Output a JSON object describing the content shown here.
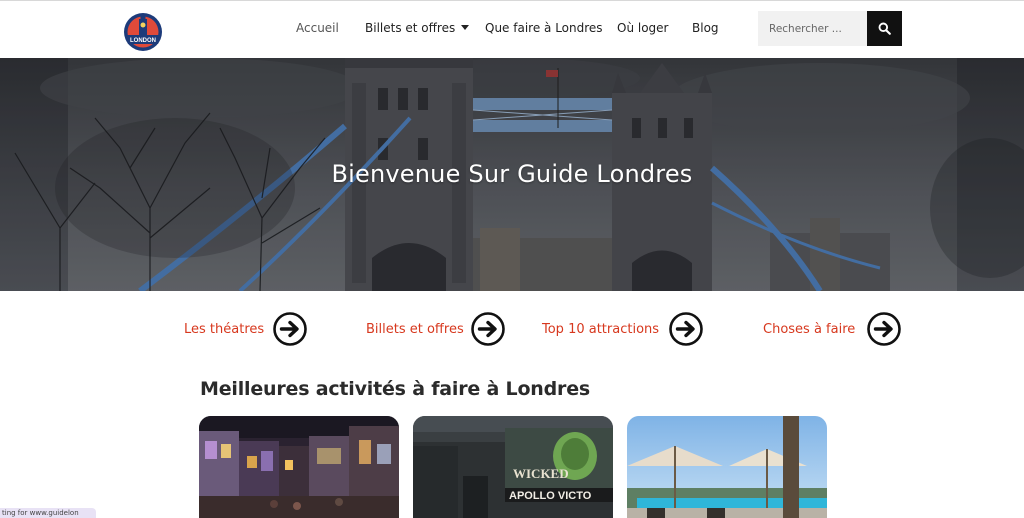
{
  "header": {
    "logo_text": "LONDON",
    "nav": [
      {
        "label": "Accueil"
      },
      {
        "label": "Billets et offres"
      },
      {
        "label": "Que faire à Londres"
      },
      {
        "label": "Où loger"
      },
      {
        "label": "Blog"
      }
    ],
    "search": {
      "placeholder": "Rechercher ..."
    }
  },
  "hero": {
    "title": "Bienvenue Sur Guide Londres"
  },
  "quick_links": [
    {
      "label": "Les théatres"
    },
    {
      "label": "Billets et offres"
    },
    {
      "label": "Top 10 attractions"
    },
    {
      "label": "Choses à faire"
    }
  ],
  "section": {
    "title": "Meilleures activités à faire à Londres"
  },
  "cards": [
    {
      "image": "harry-potter-studio-street"
    },
    {
      "image": "wicked-apollo-victoria-theatre"
    },
    {
      "image": "hotel-pool-with-parasols"
    }
  ],
  "status_bar": {
    "text": "ting for www.guidelon"
  },
  "colors": {
    "accent": "#d7381e",
    "search_button": "#111111"
  }
}
